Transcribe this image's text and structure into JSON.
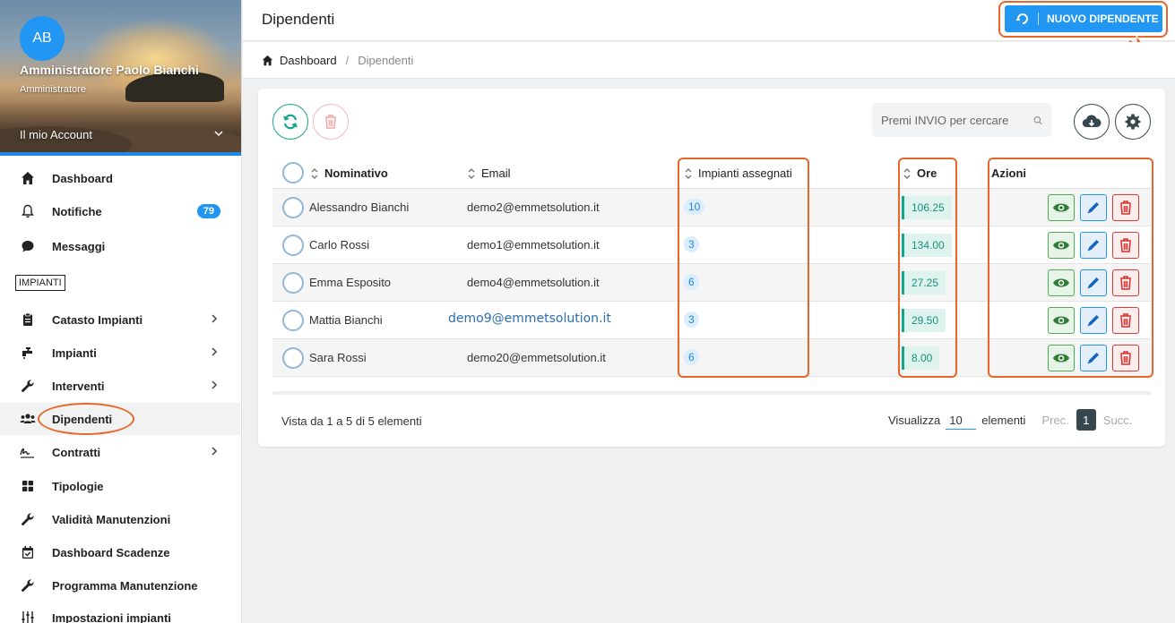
{
  "colors": {
    "accent": "#2196f3",
    "highlight": "#e8662a",
    "success": "#4caf50",
    "danger": "#e53935",
    "teal": "#17a58c"
  },
  "sidebar": {
    "avatar": "AB",
    "user_name": "Amministratore Paolo Bianchi",
    "user_role": "Amministratore",
    "account_label": "Il mio Account",
    "items": [
      {
        "label": "Dashboard",
        "icon": "home-icon"
      },
      {
        "label": "Notifiche",
        "icon": "bell-icon",
        "badge": "79"
      },
      {
        "label": "Messaggi",
        "icon": "chat-icon"
      },
      {
        "label": "Catasto Impianti",
        "icon": "clipboard-icon",
        "has_submenu": true
      },
      {
        "label": "Impianti",
        "icon": "faucet-icon",
        "has_submenu": true
      },
      {
        "label": "Interventi",
        "icon": "wrench-icon",
        "has_submenu": true
      },
      {
        "label": "Dipendenti",
        "icon": "users-icon",
        "active": true
      },
      {
        "label": "Contratti",
        "icon": "signature-icon",
        "has_submenu": true
      },
      {
        "label": "Tipologie",
        "icon": "grid-icon"
      },
      {
        "label": "Validità Manutenzioni",
        "icon": "wrench-icon"
      },
      {
        "label": "Dashboard Scadenze",
        "icon": "calendar-check-icon"
      },
      {
        "label": "Programma Manutenzione",
        "icon": "wrench-icon"
      },
      {
        "label": "Impostazioni impianti",
        "icon": "sliders-icon"
      }
    ],
    "section_label": "IMPIANTI"
  },
  "header": {
    "title": "Dipendenti",
    "new_button_label": "NUOVO DIPENDENTE"
  },
  "breadcrumb": {
    "home": "Dashboard",
    "current": "Dipendenti"
  },
  "search": {
    "placeholder": "Premi INVIO per cercare"
  },
  "table": {
    "columns": [
      "Nominativo",
      "Email",
      "Impianti assegnati",
      "Ore",
      "Azioni"
    ],
    "rows": [
      {
        "name": "Alessandro Bianchi",
        "email": "demo2@emmetsolution.it",
        "impianti": "10",
        "ore": "106.25"
      },
      {
        "name": "Carlo Rossi",
        "email": "demo1@emmetsolution.it",
        "impianti": "3",
        "ore": "134.00"
      },
      {
        "name": "Emma Esposito",
        "email": "demo4@emmetsolution.it",
        "impianti": "6",
        "ore": "27.25"
      },
      {
        "name": "Mattia Bianchi",
        "email": "demo9@emmetsolution.it",
        "impianti": "3",
        "ore": "29.50"
      },
      {
        "name": "Sara Rossi",
        "email": "demo20@emmetsolution.it",
        "impianti": "6",
        "ore": "8.00"
      }
    ]
  },
  "footer": {
    "info": "Vista da 1 a 5 di 5 elementi",
    "show_label": "Visualizza",
    "page_size": "10",
    "elements_label": "elementi",
    "prev": "Prec.",
    "current_page": "1",
    "next": "Succ."
  }
}
